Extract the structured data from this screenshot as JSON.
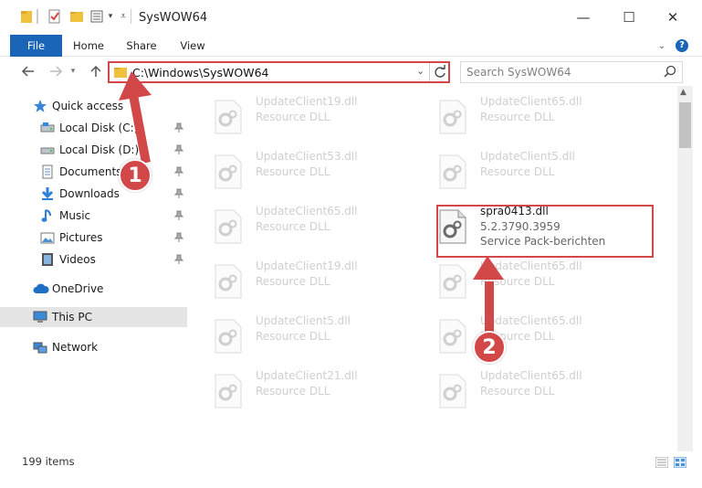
{
  "window": {
    "title": "SysWOW64",
    "minimize_glyph": "—",
    "maximize_glyph": "☐",
    "close_glyph": "✕"
  },
  "ribbon": {
    "tabs": [
      "File",
      "Home",
      "Share",
      "View"
    ],
    "help_glyph": "?"
  },
  "address": {
    "path": "C:\\Windows\\SysWOW64"
  },
  "search": {
    "placeholder": "Search SysWOW64"
  },
  "sidebar": {
    "items": [
      {
        "label": "Quick access",
        "icon": "star-icon",
        "pinned": false
      },
      {
        "label": "Local Disk (C:)",
        "icon": "drive-icon",
        "pinned": true
      },
      {
        "label": "Local Disk (D:)",
        "icon": "drive-icon",
        "pinned": true
      },
      {
        "label": "Documents",
        "icon": "documents-icon",
        "pinned": true
      },
      {
        "label": "Downloads",
        "icon": "download-icon",
        "pinned": true
      },
      {
        "label": "Music",
        "icon": "music-icon",
        "pinned": true
      },
      {
        "label": "Pictures",
        "icon": "pictures-icon",
        "pinned": true
      },
      {
        "label": "Videos",
        "icon": "videos-icon",
        "pinned": true
      },
      {
        "label": "OneDrive",
        "icon": "cloud-icon",
        "pinned": false
      },
      {
        "label": "This PC",
        "icon": "pc-icon",
        "pinned": false,
        "selected": true
      },
      {
        "label": "Network",
        "icon": "network-icon",
        "pinned": false
      }
    ]
  },
  "files": {
    "left": [
      {
        "name": "UpdateClient19.dll",
        "desc": "Resource DLL"
      },
      {
        "name": "UpdateClient53.dll",
        "desc": "Resource DLL"
      },
      {
        "name": "UpdateClient65.dll",
        "desc": "Resource DLL"
      },
      {
        "name": "UpdateClient19.dll",
        "desc": "Resource DLL"
      },
      {
        "name": "UpdateClient5.dll",
        "desc": "Resource DLL"
      },
      {
        "name": "UpdateClient21.dll",
        "desc": "Resource DLL"
      }
    ],
    "right": [
      {
        "name": "UpdateClient65.dll",
        "desc": "Resource DLL"
      },
      {
        "name": "UpdateClient5.dll",
        "desc": "Resource DLL"
      },
      {
        "name": "spra0413.dll",
        "version": "5.2.3790.3959",
        "desc": "Service Pack-berichten",
        "highlighted": true
      },
      {
        "name": "UpdateClient65.dll",
        "desc": "Resource DLL"
      },
      {
        "name": "UpdateClient65.dll",
        "desc": "Resource DLL"
      },
      {
        "name": "UpdateClient65.dll",
        "desc": "Resource DLL"
      }
    ]
  },
  "status": {
    "item_count": "199 items"
  },
  "callouts": {
    "one": "1",
    "two": "2"
  },
  "colors": {
    "accent": "#1a65b8",
    "annotation_red": "#d24747"
  }
}
